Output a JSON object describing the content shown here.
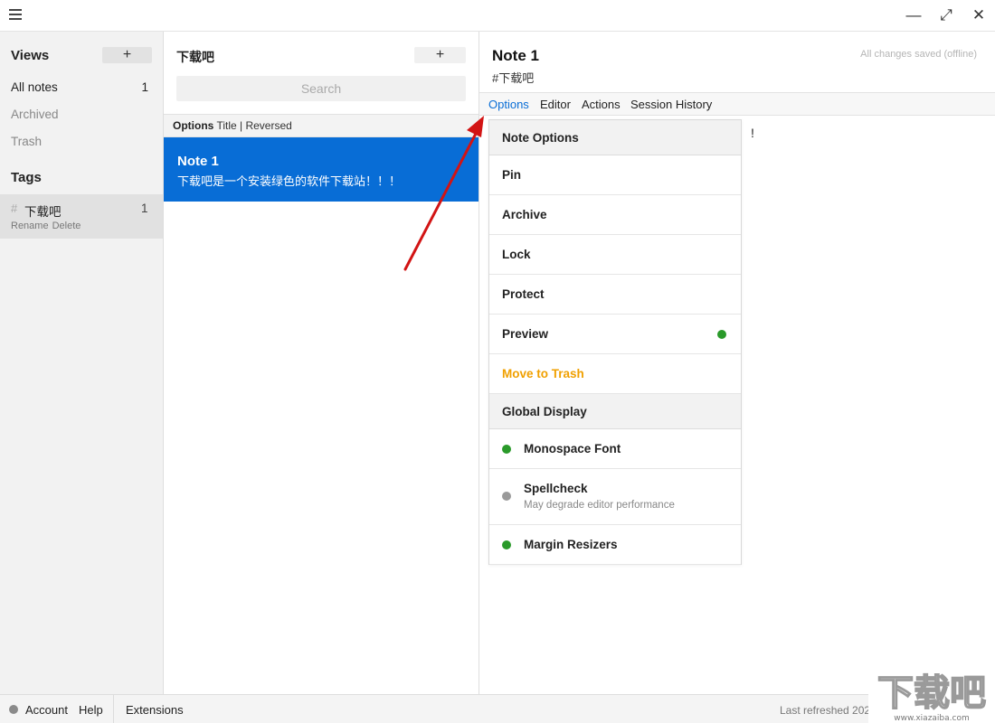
{
  "window": {
    "menu_icon": "hamburger-icon",
    "minimize": "—",
    "maximize": "⤢",
    "close": "✕"
  },
  "sidebar": {
    "views_title": "Views",
    "add_label": "+",
    "items": [
      {
        "label": "All notes",
        "count": "1"
      },
      {
        "label": "Archived",
        "count": ""
      },
      {
        "label": "Trash",
        "count": ""
      }
    ],
    "tags_title": "Tags",
    "tag": {
      "hash": "#",
      "name": "下载吧",
      "count": "1",
      "rename": "Rename",
      "delete": "Delete"
    }
  },
  "notes_list": {
    "title": "下载吧",
    "add_label": "+",
    "search_placeholder": "Search",
    "options_label": "Options",
    "sort_label": "Title | Reversed",
    "note": {
      "title": "Note 1",
      "preview": "下载吧是一个安装绿色的软件下载站！！！"
    }
  },
  "editor": {
    "title": "Note 1",
    "tag": "#下载吧",
    "saved_status": "All changes saved (offline)",
    "tabs": [
      "Options",
      "Editor",
      "Actions",
      "Session History"
    ],
    "content": "!"
  },
  "options_menu": {
    "note_options_header": "Note Options",
    "items": [
      {
        "label": "Pin"
      },
      {
        "label": "Archive"
      },
      {
        "label": "Lock"
      },
      {
        "label": "Protect"
      },
      {
        "label": "Preview",
        "state": "on"
      },
      {
        "label": "Move to Trash"
      }
    ],
    "global_header": "Global Display",
    "global_items": [
      {
        "label": "Monospace Font",
        "state": "on"
      },
      {
        "label": "Spellcheck",
        "sub": "May degrade editor performance",
        "state": "off"
      },
      {
        "label": "Margin Resizers",
        "state": "on"
      }
    ],
    "colors": {
      "on": "#2a9a2a",
      "off": "#9a9a9a",
      "trash": "#f0a000",
      "accent": "#086dd6"
    }
  },
  "footer": {
    "account": "Account",
    "help": "Help",
    "extensions": "Extensions",
    "refreshed": "Last refreshed 2021,"
  },
  "watermark": {
    "text": "下载吧",
    "url": "www.xiazaiba.com"
  }
}
